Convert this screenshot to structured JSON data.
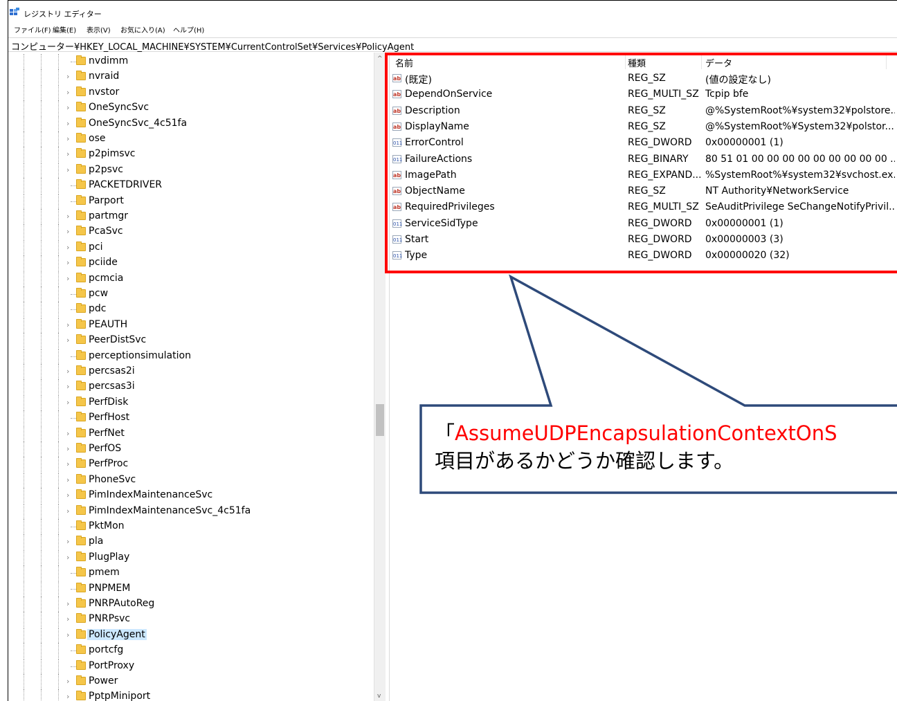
{
  "window": {
    "title": "レジストリ エディター"
  },
  "menu": [
    "ファイル(F)",
    "編集(E)",
    "表示(V)",
    "お気に入り(A)",
    "ヘルプ(H)"
  ],
  "address": "コンピューター¥HKEY_LOCAL_MACHINE¥SYSTEM¥CurrentControlSet¥Services¥PolicyAgent",
  "tree": {
    "selected": "PolicyAgent",
    "items": [
      {
        "label": "nvdimm",
        "expandable": false
      },
      {
        "label": "nvraid",
        "expandable": true
      },
      {
        "label": "nvstor",
        "expandable": true
      },
      {
        "label": "OneSyncSvc",
        "expandable": true
      },
      {
        "label": "OneSyncSvc_4c51fa",
        "expandable": true
      },
      {
        "label": "ose",
        "expandable": true
      },
      {
        "label": "p2pimsvc",
        "expandable": true
      },
      {
        "label": "p2psvc",
        "expandable": true
      },
      {
        "label": "PACKETDRIVER",
        "expandable": false
      },
      {
        "label": "Parport",
        "expandable": false
      },
      {
        "label": "partmgr",
        "expandable": true
      },
      {
        "label": "PcaSvc",
        "expandable": true
      },
      {
        "label": "pci",
        "expandable": true
      },
      {
        "label": "pciide",
        "expandable": true
      },
      {
        "label": "pcmcia",
        "expandable": true
      },
      {
        "label": "pcw",
        "expandable": false
      },
      {
        "label": "pdc",
        "expandable": false
      },
      {
        "label": "PEAUTH",
        "expandable": true
      },
      {
        "label": "PeerDistSvc",
        "expandable": true
      },
      {
        "label": "perceptionsimulation",
        "expandable": false
      },
      {
        "label": "percsas2i",
        "expandable": true
      },
      {
        "label": "percsas3i",
        "expandable": true
      },
      {
        "label": "PerfDisk",
        "expandable": true
      },
      {
        "label": "PerfHost",
        "expandable": false
      },
      {
        "label": "PerfNet",
        "expandable": true
      },
      {
        "label": "PerfOS",
        "expandable": true
      },
      {
        "label": "PerfProc",
        "expandable": true
      },
      {
        "label": "PhoneSvc",
        "expandable": true
      },
      {
        "label": "PimIndexMaintenanceSvc",
        "expandable": true
      },
      {
        "label": "PimIndexMaintenanceSvc_4c51fa",
        "expandable": true
      },
      {
        "label": "PktMon",
        "expandable": false
      },
      {
        "label": "pla",
        "expandable": true
      },
      {
        "label": "PlugPlay",
        "expandable": true
      },
      {
        "label": "pmem",
        "expandable": false
      },
      {
        "label": "PNPMEM",
        "expandable": false
      },
      {
        "label": "PNRPAutoReg",
        "expandable": true
      },
      {
        "label": "PNRPsvc",
        "expandable": true
      },
      {
        "label": "PolicyAgent",
        "expandable": true
      },
      {
        "label": "portcfg",
        "expandable": false
      },
      {
        "label": "PortProxy",
        "expandable": false
      },
      {
        "label": "Power",
        "expandable": true
      },
      {
        "label": "PptpMiniport",
        "expandable": true
      }
    ]
  },
  "list": {
    "columns": {
      "name": "名前",
      "type": "種類",
      "data": "データ"
    },
    "rows": [
      {
        "icon": "string-value-icon",
        "kind": "sz",
        "name": "(既定)",
        "type": "REG_SZ",
        "data": "(値の設定なし)"
      },
      {
        "icon": "string-value-icon",
        "kind": "sz",
        "name": "DependOnService",
        "type": "REG_MULTI_SZ",
        "data": "Tcpip bfe"
      },
      {
        "icon": "string-value-icon",
        "kind": "sz",
        "name": "Description",
        "type": "REG_SZ",
        "data": "@%SystemRoot%¥system32¥polstore..."
      },
      {
        "icon": "string-value-icon",
        "kind": "sz",
        "name": "DisplayName",
        "type": "REG_SZ",
        "data": "@%SystemRoot%¥System32¥polstor..."
      },
      {
        "icon": "binary-value-icon",
        "kind": "bin",
        "name": "ErrorControl",
        "type": "REG_DWORD",
        "data": "0x00000001 (1)"
      },
      {
        "icon": "binary-value-icon",
        "kind": "bin",
        "name": "FailureActions",
        "type": "REG_BINARY",
        "data": "80 51 01 00 00 00 00 00 00 00 00 00 ..."
      },
      {
        "icon": "string-value-icon",
        "kind": "sz",
        "name": "ImagePath",
        "type": "REG_EXPAND...",
        "data": "%SystemRoot%¥system32¥svchost.ex..."
      },
      {
        "icon": "string-value-icon",
        "kind": "sz",
        "name": "ObjectName",
        "type": "REG_SZ",
        "data": "NT Authority¥NetworkService"
      },
      {
        "icon": "string-value-icon",
        "kind": "sz",
        "name": "RequiredPrivileges",
        "type": "REG_MULTI_SZ",
        "data": "SeAuditPrivilege SeChangeNotifyPrivil..."
      },
      {
        "icon": "binary-value-icon",
        "kind": "bin",
        "name": "ServiceSidType",
        "type": "REG_DWORD",
        "data": "0x00000001 (1)"
      },
      {
        "icon": "binary-value-icon",
        "kind": "bin",
        "name": "Start",
        "type": "REG_DWORD",
        "data": "0x00000003 (3)"
      },
      {
        "icon": "binary-value-icon",
        "kind": "bin",
        "name": "Type",
        "type": "REG_DWORD",
        "data": "0x00000020 (32)"
      }
    ]
  },
  "annotation": {
    "open_bracket": "「",
    "key_text": "AssumeUDPEncapsulationContextOnS",
    "line2": "項目があるかどうか確認します。",
    "highlight_color": "#ff0000",
    "callout_border_color": "#2e4a7a"
  }
}
